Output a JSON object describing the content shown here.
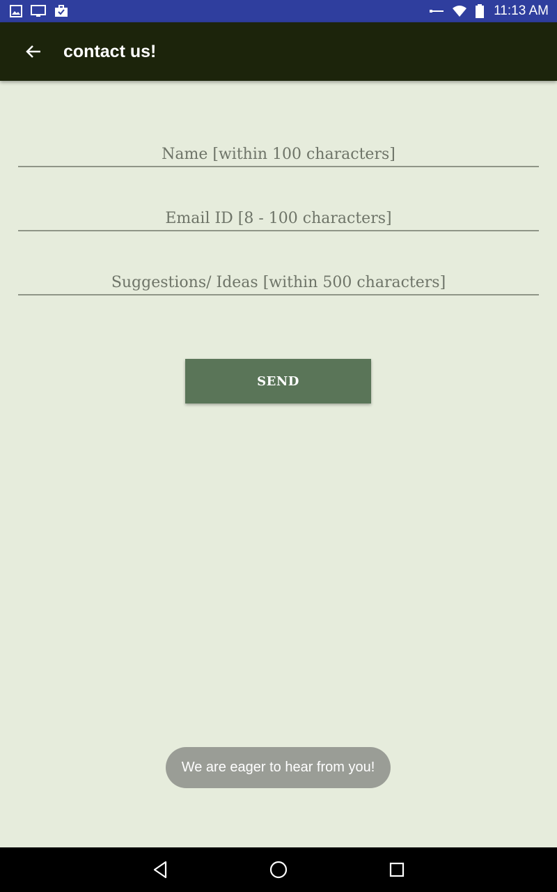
{
  "status_bar": {
    "time": "11:13 AM",
    "left_icons": [
      "image-icon",
      "monitor-icon",
      "briefcase-check-icon"
    ],
    "right_icons": [
      "dash-icon",
      "wifi-icon",
      "battery-icon"
    ]
  },
  "app_bar": {
    "back_icon": "arrow-back-icon",
    "title": "contact us!",
    "background": "#1c240b"
  },
  "form": {
    "name_placeholder": "Name [within 100 characters]",
    "name_value": "",
    "email_placeholder": "Email ID [8 - 100 characters]",
    "email_value": "",
    "ideas_placeholder": "Suggestions/ Ideas [within 500 characters]",
    "ideas_value": "",
    "send_label": "SEND",
    "send_color": "#5a7558"
  },
  "toast": {
    "message": "We are eager to hear from you!"
  },
  "nav_bar": {
    "icons": [
      "back-triangle-icon",
      "home-circle-icon",
      "recents-square-icon"
    ]
  },
  "colors": {
    "background": "#e6ecdc",
    "status_bar": "#2f3e9e"
  }
}
